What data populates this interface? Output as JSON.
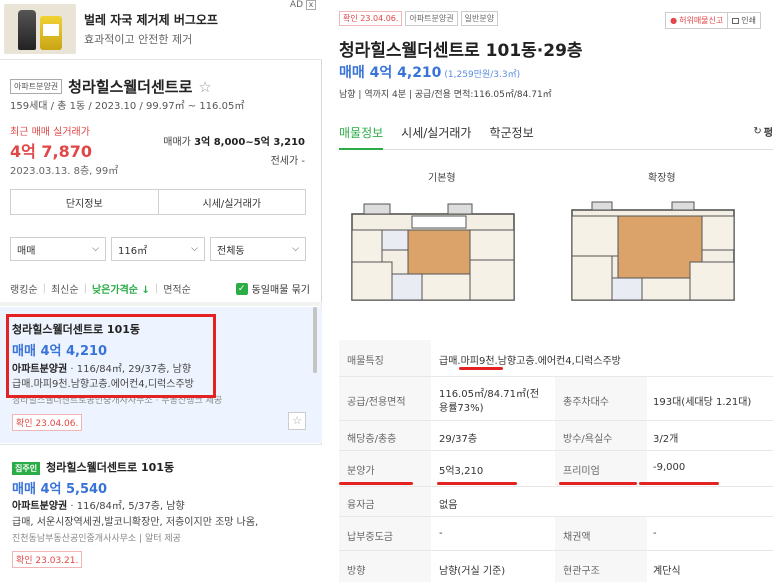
{
  "ad": {
    "title": "벌레 자국 제거제 버그오프",
    "desc": "효과적이고 안전한 제거",
    "badge": "AD",
    "close": "x"
  },
  "complex": {
    "type_tag": "아파트분양권",
    "name": "청라힐스웰더센트로",
    "info": "159세대 / 총 1동 / 2023.10 / 99.97㎡ ~ 116.05㎡",
    "recent_label": "최근 매매 실거래가",
    "recent_price": "4억 7,870",
    "recent_date": "2023.03.13. 8층, 99㎡",
    "sale_label": "매매가",
    "sale_value": "3억 8,000~5억 3,210",
    "jeonse": "전세가 -",
    "buttons": [
      "단지정보",
      "시세/실거래가"
    ]
  },
  "filters": [
    {
      "value": "매매"
    },
    {
      "value": "116㎡"
    },
    {
      "value": "전체동"
    }
  ],
  "sorts": {
    "items": [
      "랭킹순",
      "최신순",
      "낮은가격순 ↓",
      "면적순"
    ],
    "same_group": "동일매물 묶기"
  },
  "listings": [
    {
      "title": "청라힐스웰더센트로 101동",
      "price": "매매 4억 4,210",
      "type": "아파트분양권",
      "spec": " · 116/84㎡, 29/37층, 남향",
      "features": "급매.마피9천.남향고층.에어컨4,디럭스주방",
      "agent": "청라힐스웰더센트로공인중개사사무소 · 부동산뱅크 제공",
      "confirm": "확인 23.04.06."
    },
    {
      "tag": "집주인",
      "title": "청라힐스웰더센트로 101동",
      "price": "매매 4억 5,540",
      "type": "아파트분양권",
      "spec": " · 116/84㎡, 5/37층, 남향",
      "features": "급매, 서운시장역세권,발코니확장만, 저층이지만 조망 나옴,",
      "agent": "진천동남부동산공인중개사사무소 | 알터 제공",
      "confirm": "확인 23.03.21."
    }
  ],
  "detail": {
    "tags": [
      "확인 23.04.06.",
      "아파트분양권",
      "일반분양"
    ],
    "report": "허위매물신고",
    "print": "인쇄",
    "title": "청라힐스웰더센트로 101동·29층",
    "price": "매매 4억 4,210",
    "pyeong": "(1,259만원/3.3㎡)",
    "sub": "남향  |  역까지 4분  |  공급/전용 면적:116.05㎡/84.71㎡",
    "tabs": [
      "매물정보",
      "시세/실거래가",
      "학군정보"
    ],
    "tab_right": "펑",
    "plan_labels": [
      "기본형",
      "확장형"
    ],
    "facts": [
      {
        "k": "매물특징",
        "v": "급매.마피9천.남향고층.에어컨4,디럭스주방"
      },
      {
        "k": "공급/전용면적",
        "v": "116.05㎡/84.71㎡(전",
        "v_b": "용률73%)",
        "k2": "총주차대수",
        "v2": "193대(세대당 1.21대)"
      },
      {
        "k": "해당층/총층",
        "v": "29/37층",
        "k2": "방수/욕실수",
        "v2": "3/2개"
      },
      {
        "k": "분양가",
        "v": "5억3,210",
        "k2": "프리미엄",
        "v2": "-9,000"
      },
      {
        "k": "융자금",
        "v": "없음"
      },
      {
        "k": "납부중도금",
        "v": "-",
        "k2": "채권액",
        "v2": "-"
      },
      {
        "k": "방향",
        "v": "남향(거실 기준)",
        "k2": "현관구조",
        "v2": "계단식"
      }
    ]
  },
  "colors": {
    "accent_green": "#2bac47",
    "price_blue": "#3873d8",
    "alert_red": "#e24747",
    "highlight_red": "#e52222"
  }
}
